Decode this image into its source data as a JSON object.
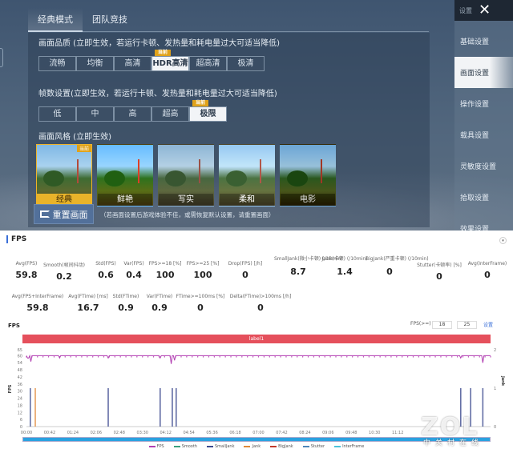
{
  "game": {
    "tabs": [
      "经典模式",
      "团队竞技"
    ],
    "quality_title": "画面品质 (立即生效，若运行卡顿、发热量和耗电量过大可适当降低)",
    "quality_options": [
      "流畅",
      "均衡",
      "高清",
      "HDR高清",
      "超高清",
      "极清"
    ],
    "quality_selected": "HDR高清",
    "current_badge": "当前",
    "fps_title": "帧数设置(立即生效，若运行卡顿、发热量和耗电量过大可适当降低)",
    "fps_options": [
      "低",
      "中",
      "高",
      "超高",
      "极限"
    ],
    "fps_selected": "极限",
    "style_title": "画面风格 (立即生效)",
    "styles": [
      "经典",
      "鲜艳",
      "写实",
      "柔和",
      "电影"
    ],
    "style_selected": "经典",
    "reset_label": "重置画面",
    "reset_note": "（若画面设置后游戏体验不佳，或需恢复默认设置，请重置画面）",
    "side_title": "设置",
    "side_items": [
      "基础设置",
      "画面设置",
      "操作设置",
      "载具设置",
      "灵敏度设置",
      "拾取设置",
      "效果设置"
    ],
    "side_selected": "画面设置"
  },
  "perf": {
    "header": "FPS",
    "row1": [
      {
        "label": "Avg(FPS)",
        "value": "59.8"
      },
      {
        "label": "Smooth(帧间抖动)",
        "value": "0.2"
      },
      {
        "label": "Std(FPS)",
        "value": "0.6"
      },
      {
        "label": "Var(FPS)",
        "value": "0.4"
      },
      {
        "label": "FPS>=18 [%]",
        "value": "100"
      },
      {
        "label": "FPS>=25 [%]",
        "value": "100"
      },
      {
        "label": "Drop(FPS) [/h]",
        "value": "0"
      },
      {
        "label": "SmallJank(微小卡顿) (/10min)",
        "value": "8.7"
      },
      {
        "label": "Jank(卡顿) (/10min)",
        "value": "1.4"
      },
      {
        "label": "BigJank(严重卡顿) (/10min)",
        "value": "0"
      },
      {
        "label": "Stutter(卡顿率) [%]",
        "value": "0"
      },
      {
        "label": "Avg(InterFrame)",
        "value": "0"
      }
    ],
    "row2": [
      {
        "label": "Avg(FPS+InterFrame)",
        "value": "59.8"
      },
      {
        "label": "Avg(FTime) [ms]",
        "value": "16.7"
      },
      {
        "label": "Std(FTime)",
        "value": "0.9"
      },
      {
        "label": "Var(FTime)",
        "value": "0.9"
      },
      {
        "label": "FTime>=100ms [%]",
        "value": "0"
      },
      {
        "label": "Delta(FTime)>100ms [/h]",
        "value": "0"
      }
    ],
    "chart_title": "FPS",
    "fps_threshold_label": "FPS(>=)",
    "fps_threshold_values": [
      "18",
      "25"
    ],
    "apply_label": "设置",
    "label_bar": "label1",
    "watermark": "ZOL",
    "watermark_sub": "中关村在线"
  },
  "chart_data": {
    "type": "line",
    "title": "FPS",
    "ylabel": "FPS",
    "y2label": "Jank",
    "ylim": [
      0,
      65
    ],
    "y2lim": [
      0,
      2
    ],
    "yticks": [
      0,
      6,
      12,
      18,
      24,
      30,
      36,
      42,
      48,
      54,
      60,
      65
    ],
    "y2ticks": [
      0,
      1,
      2
    ],
    "xlim_seconds": [
      0,
      840
    ],
    "xticks": [
      "00:00",
      "00:42",
      "01:24",
      "02:06",
      "02:48",
      "03:30",
      "04:12",
      "04:54",
      "05:36",
      "06:18",
      "07:00",
      "07:42",
      "08:24",
      "09:06",
      "09:48",
      "10:30",
      "11:12"
    ],
    "fps_baseline": 60,
    "fps_dips": [
      [
        3,
        58
      ],
      [
        8,
        55
      ],
      [
        60,
        58
      ],
      [
        148,
        58
      ],
      [
        242,
        58
      ],
      [
        262,
        53
      ],
      [
        268,
        56
      ],
      [
        786,
        58
      ],
      [
        826,
        54
      ]
    ],
    "jank_spikes": [
      {
        "t": 7,
        "series": "SmallJank"
      },
      {
        "t": 16,
        "series": "Jank"
      },
      {
        "t": 148,
        "series": "SmallJank"
      },
      {
        "t": 242,
        "series": "SmallJank"
      },
      {
        "t": 264,
        "series": "SmallJank"
      },
      {
        "t": 271,
        "series": "SmallJank"
      },
      {
        "t": 786,
        "series": "SmallJank"
      },
      {
        "t": 804,
        "series": "SmallJank"
      },
      {
        "t": 826,
        "series": "SmallJank"
      }
    ],
    "legend": [
      {
        "name": "FPS",
        "color": "#b23fb2"
      },
      {
        "name": "Smooth",
        "color": "#3aa17e"
      },
      {
        "name": "SmallJank",
        "color": "#3c4a8f"
      },
      {
        "name": "Jank",
        "color": "#e08a3a"
      },
      {
        "name": "BigJank",
        "color": "#c0392b"
      },
      {
        "name": "Stutter",
        "color": "#4f86b8"
      },
      {
        "name": "InterFrame",
        "color": "#4cc3d9"
      }
    ],
    "legend_position": "bottom"
  }
}
